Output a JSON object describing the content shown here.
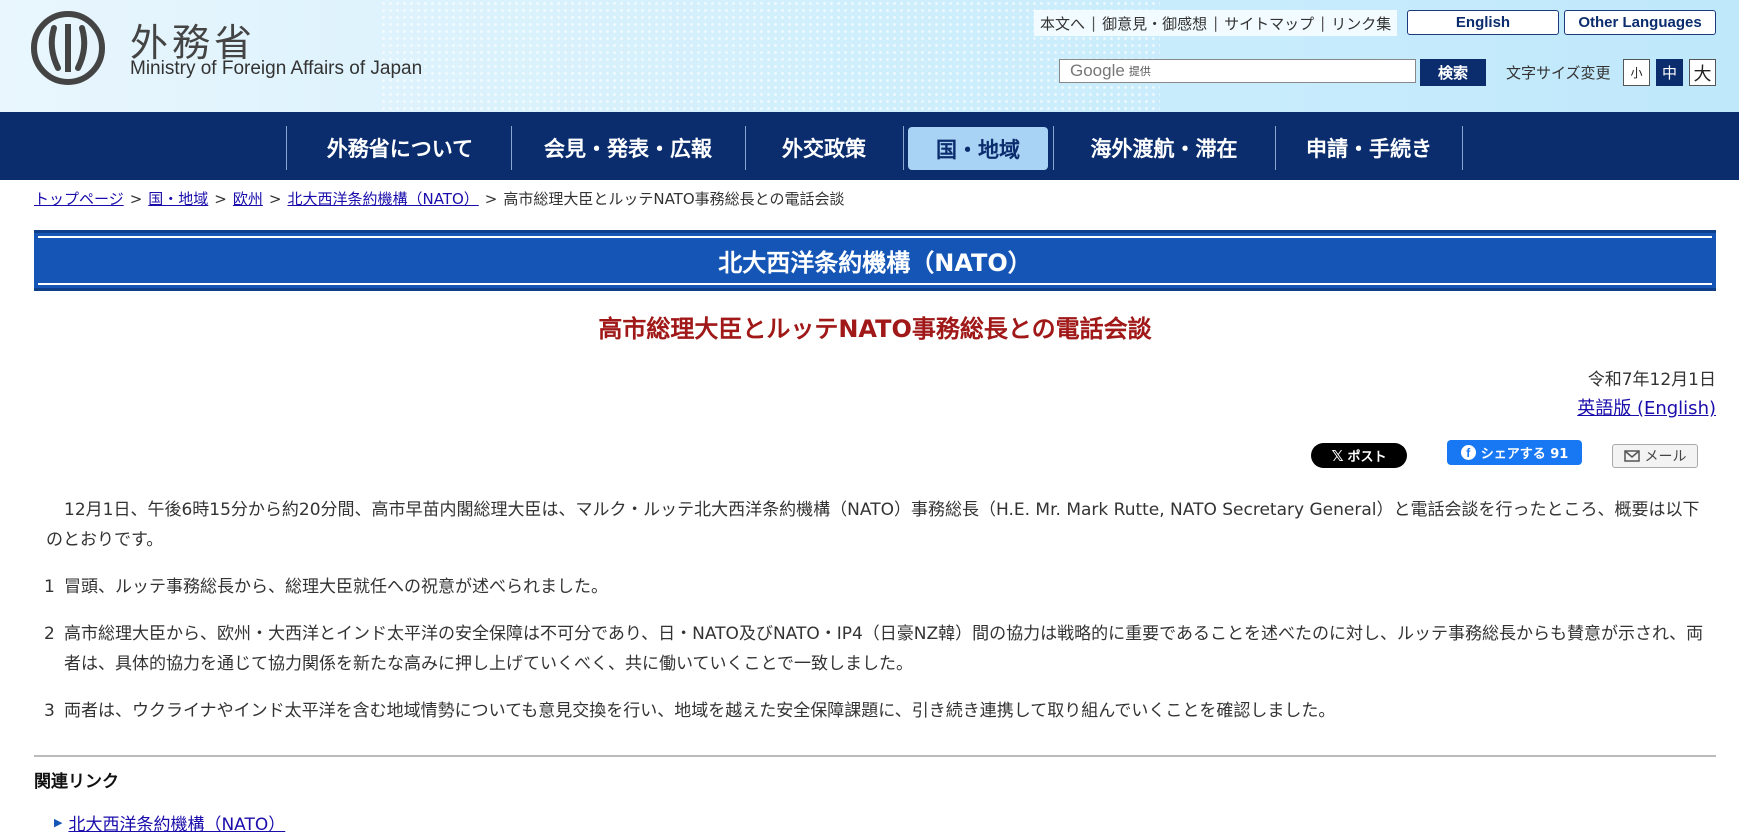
{
  "header": {
    "logo_jp": "外務省",
    "logo_en": "Ministry of Foreign Affairs of Japan",
    "util_links": [
      "本文へ",
      "御意見・御感想",
      "サイトマップ",
      "リンク集"
    ],
    "english_button": "English",
    "other_languages_button": "Other Languages",
    "search_brand": "Google",
    "search_provided": "提供",
    "search_button": "検索",
    "font_size_label": "文字サイズ変更",
    "font_sizes": [
      "小",
      "中",
      "大"
    ]
  },
  "nav": {
    "items": [
      "外務省について",
      "会見・発表・広報",
      "外交政策",
      "国・地域",
      "海外渡航・滞在",
      "申請・手続き"
    ],
    "active": "国・地域"
  },
  "breadcrumb": {
    "items": [
      "トップページ",
      "国・地域",
      "欧州",
      "北大西洋条約機構（NATO）"
    ],
    "current": "高市総理大臣とルッテNATO事務総長との電話会談",
    "separator": ">"
  },
  "section_title": "北大西洋条約機構（NATO）",
  "article": {
    "title": "高市総理大臣とルッテNATO事務総長との電話会談",
    "date": "令和7年12月1日",
    "english_link": "英語版 (English)",
    "intro": "12月1日、午後6時15分から約20分間、高市早苗内閣総理大臣は、マルク・ルッテ北大西洋条約機構（NATO）事務総長（H.E. Mr. Mark Rutte, NATO Secretary General）と電話会談を行ったところ、概要は以下のとおりです。",
    "points": [
      {
        "num": "1",
        "text": "冒頭、ルッテ事務総長から、総理大臣就任への祝意が述べられました。"
      },
      {
        "num": "2",
        "text": "高市総理大臣から、欧州・大西洋とインド太平洋の安全保障は不可分であり、日・NATO及びNATO・IP4（日豪NZ韓）間の協力は戦略的に重要であることを述べたのに対し、ルッテ事務総長からも賛意が示され、両者は、具体的協力を通じて協力関係を新たな高みに押し上げていくべく、共に働いていくことで一致しました。"
      },
      {
        "num": "3",
        "text": "両者は、ウクライナやインド太平洋を含む地域情勢についても意見交換を行い、地域を越えた安全保障課題に、引き続き連携して取り組んでいくことを確認しました。"
      }
    ]
  },
  "share": {
    "x_label": "ポスト",
    "fb_label": "シェアする 91",
    "mail_label": "メール"
  },
  "related": {
    "title": "関連リンク",
    "links": [
      "北大西洋条約機構（NATO）"
    ]
  },
  "colors": {
    "nav_bg": "#0b2d6e",
    "banner_bg": "#1455b6",
    "title_red": "#a01818",
    "link": "#1a0dab"
  }
}
